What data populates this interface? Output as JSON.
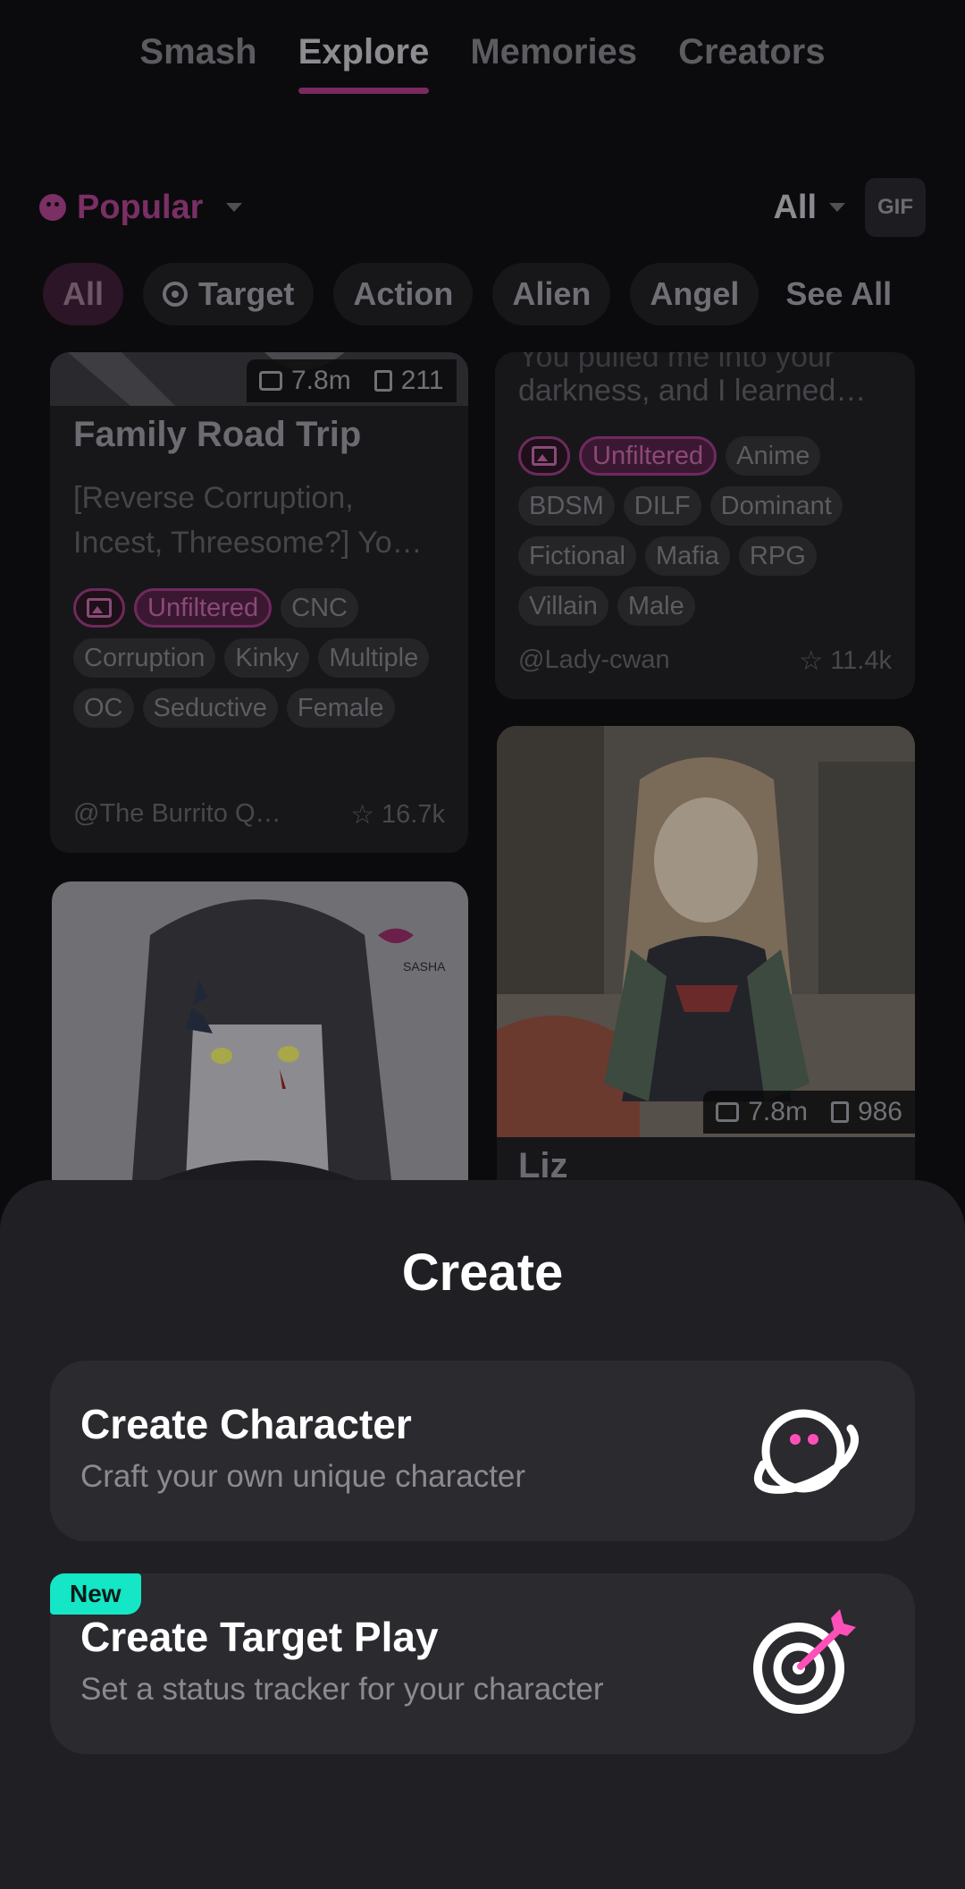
{
  "tabs": [
    {
      "label": "Smash",
      "active": false
    },
    {
      "label": "Explore",
      "active": true
    },
    {
      "label": "Memories",
      "active": false
    },
    {
      "label": "Creators",
      "active": false
    }
  ],
  "filters": {
    "sort_label": "Popular",
    "type_label": "All",
    "gif_label": "GIF"
  },
  "chips": [
    "All",
    "Target",
    "Action",
    "Alien",
    "Angel",
    "See All"
  ],
  "cards": {
    "family": {
      "messages": "7.8m",
      "saves": "211",
      "title": "Family Road Trip",
      "desc": "[Reverse Corruption, Incest, Threesome?] Yo…",
      "tags": [
        "Unfiltered",
        "CNC",
        "Corruption",
        "Kinky",
        "Multiple",
        "OC",
        "Seductive",
        "Female"
      ],
      "author": "@The Burrito Q…",
      "rating": "16.7k"
    },
    "mafia": {
      "desc_top": "You pulled me into your",
      "desc": "darkness, and I learned…",
      "tags": [
        "Unfiltered",
        "Anime",
        "BDSM",
        "DILF",
        "Dominant",
        "Fictional",
        "Mafia",
        "RPG",
        "Villain",
        "Male"
      ],
      "author": "@Lady-cwan",
      "rating": "11.4k"
    },
    "liz": {
      "messages": "7.8m",
      "saves": "986",
      "title": "Liz"
    },
    "sasha": {
      "logo_text": "SASHA"
    }
  },
  "sheet": {
    "title": "Create",
    "options": [
      {
        "title": "Create Character",
        "subtitle": "Craft your own unique character",
        "icon": "planet-icon"
      },
      {
        "title": "Create Target Play",
        "subtitle": "Set a status tracker for your character",
        "icon": "target-icon",
        "badge": "New"
      }
    ]
  },
  "colors": {
    "accent": "#ff4fb8",
    "badge": "#14e6c6",
    "sheet": "#202024"
  }
}
